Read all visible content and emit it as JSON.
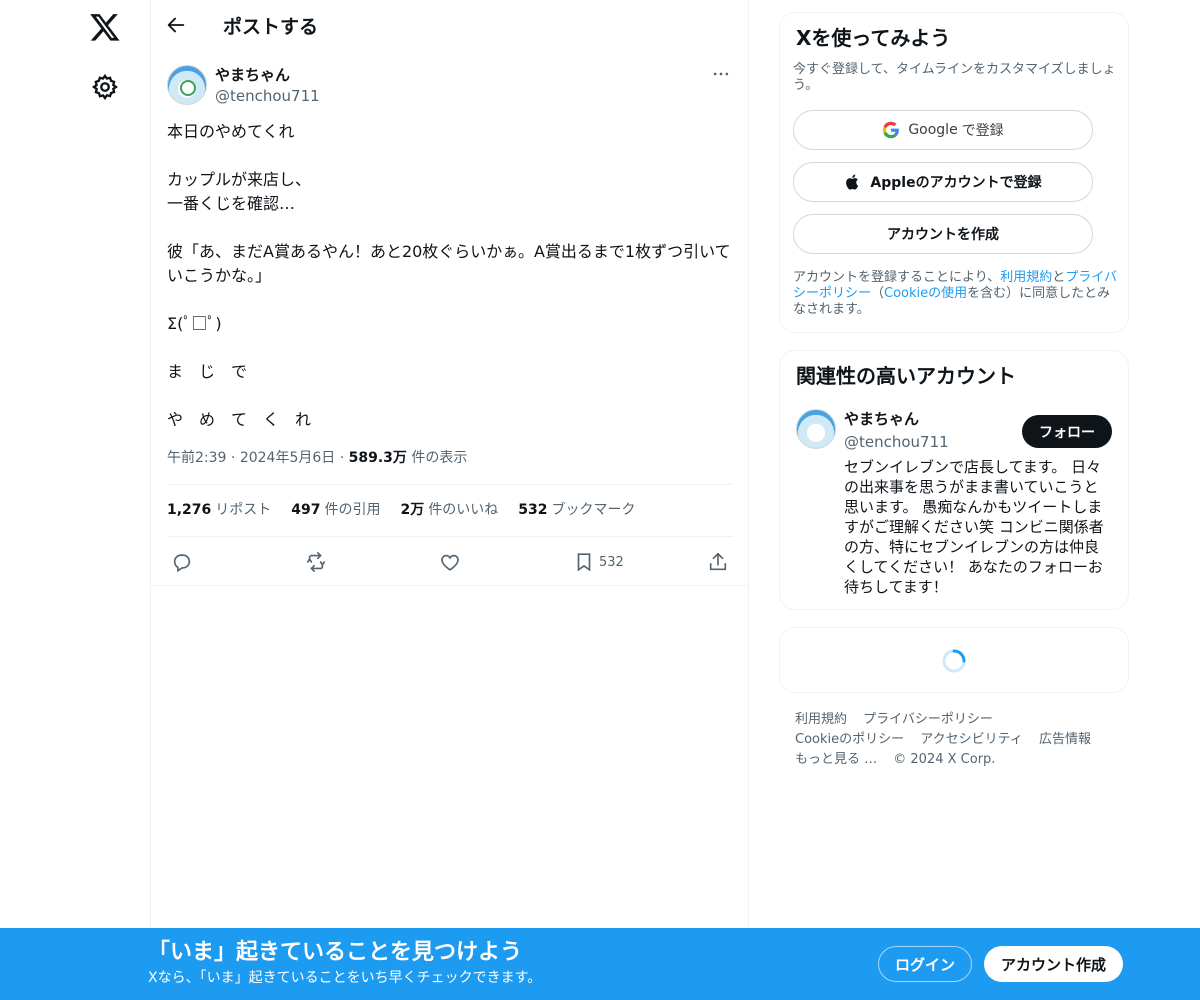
{
  "colors": {
    "accent": "#1d9bf0",
    "text": "#0f1419",
    "muted": "#536471",
    "border": "#eff3f4"
  },
  "nav": {
    "logo_icon": "x-logo-icon",
    "settings_icon": "gear-icon"
  },
  "header": {
    "title": "ポストする",
    "back_icon": "arrow-left-icon"
  },
  "post": {
    "author_name": "やまちゃん",
    "author_handle": "@tenchou711",
    "lines": [
      "本日のやめてくれ",
      "カップルが来店し、\n一番くじを確認…",
      "彼「あ、まだA賞あるやん！あと20枚ぐらいかぁ。A賞出るまで1枚ずつ引いていこうかな。」",
      "Σ(ﾟ□ﾟ)",
      "ま　じ　で",
      "や　め　て　く　れ"
    ],
    "time": "午前2:39",
    "date": "2024年5月6日",
    "views_value": "589.3万",
    "views_label": "件の表示",
    "stats": {
      "reposts_value": "1,276",
      "reposts_label": "リポスト",
      "quotes_value": "497",
      "quotes_label": "件の引用",
      "likes_value": "2万",
      "likes_label": "件のいいね",
      "bookmarks_value": "532",
      "bookmarks_label": "ブックマーク"
    },
    "actions": {
      "bookmark_count": "532"
    }
  },
  "signup_card": {
    "title": "Xを使ってみよう",
    "subtitle": "今すぐ登録して、タイムラインをカスタマイズしましょう。",
    "google_brand": "Google",
    "google_label": "で登録",
    "apple_label": "Appleのアカウントで登録",
    "create_label": "アカウントを作成",
    "terms_prefix": "アカウントを登録することにより、",
    "terms_link": "利用規約",
    "terms_and": "と",
    "privacy_link": "プライバシーポリシー",
    "terms_paren_open": "（",
    "cookie_link": "Cookieの使用",
    "terms_suffix": "を含む）に同意したとみなされます。"
  },
  "related": {
    "title": "関連性の高いアカウント",
    "name": "やまちゃん",
    "handle": "@tenchou711",
    "follow_label": "フォロー",
    "bio": "セブンイレブンで店長してます。 日々の出来事を思うがまま書いていこうと思います。 愚痴なんかもツイートしますがご理解ください笑 コンビニ関係者の方、特にセブンイレブンの方は仲良くしてください！ あなたのフォローお待ちしてます！"
  },
  "footer": {
    "terms": "利用規約",
    "privacy": "プライバシーポリシー",
    "cookie": "Cookieのポリシー",
    "accessibility": "アクセシビリティ",
    "ads": "広告情報",
    "more": "もっと見る …",
    "copyright": "© 2024 X Corp."
  },
  "banner": {
    "title": "「いま」起きていることを見つけよう",
    "subtitle": "Xなら、「いま」起きていることをいち早くチェックできます。",
    "login_label": "ログイン",
    "signup_label": "アカウント作成"
  }
}
